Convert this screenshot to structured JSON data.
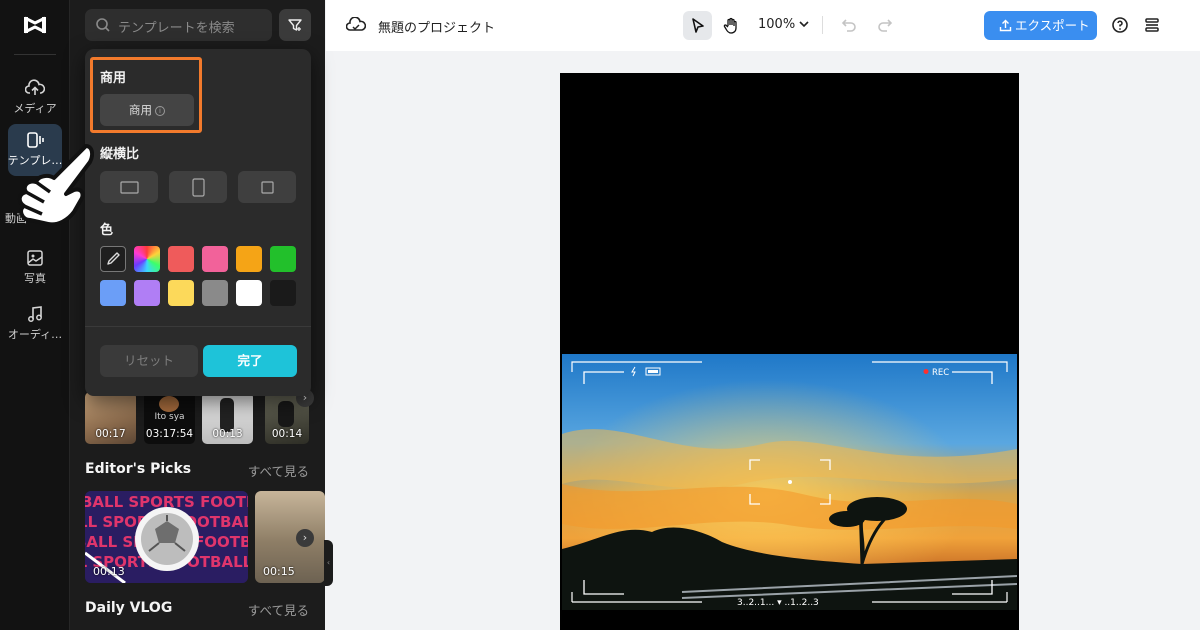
{
  "rail": {
    "items": [
      {
        "label": "メディア",
        "icon": "cloud-upload-icon"
      },
      {
        "label": "テンプレ…",
        "icon": "template-icon",
        "active": true
      },
      {
        "label": "動画",
        "icon": "video-icon"
      },
      {
        "label": "写真",
        "icon": "image-icon"
      },
      {
        "label": "オーディ…",
        "icon": "music-icon"
      }
    ]
  },
  "panel": {
    "search_placeholder": "テンプレートを検索",
    "thumb_durations": [
      "00:17",
      "03:17:54",
      "00:13",
      "00:14"
    ],
    "thumb_caption": "Ito sya",
    "sections": [
      {
        "title": "Editor's Picks",
        "see_all": "すべて見る"
      },
      {
        "title": "Daily VLOG",
        "see_all": "すべて見る"
      }
    ],
    "picks_durations": [
      "00:13",
      "00:15"
    ],
    "picks_banner_text": "BALL SPORTS FOOTBALL"
  },
  "filter": {
    "commercial_label": "商用",
    "commercial_chip": "商用",
    "commercial_info_glyph": "i",
    "aspect_label": "縦横比",
    "color_label": "色",
    "swatches": [
      "picker",
      "rainbow",
      "#ef5b5b",
      "#f2629a",
      "#f5a416",
      "#22c02b",
      "#6b9ef7",
      "#b07ef5",
      "#fcd95a",
      "#8a8a8a",
      "#ffffff",
      "#1a1a1a"
    ],
    "reset_label": "リセット",
    "done_label": "完了",
    "highlight_color": "#f27a2c"
  },
  "topbar": {
    "project_title": "無題のプロジェクト",
    "zoom": "100%",
    "export_label": "エクスポート",
    "accent": "#3a8ef0"
  },
  "video_overlay": {
    "rec": "REC",
    "countdown": "3..2..1...  ▾  ..1..2..3"
  }
}
